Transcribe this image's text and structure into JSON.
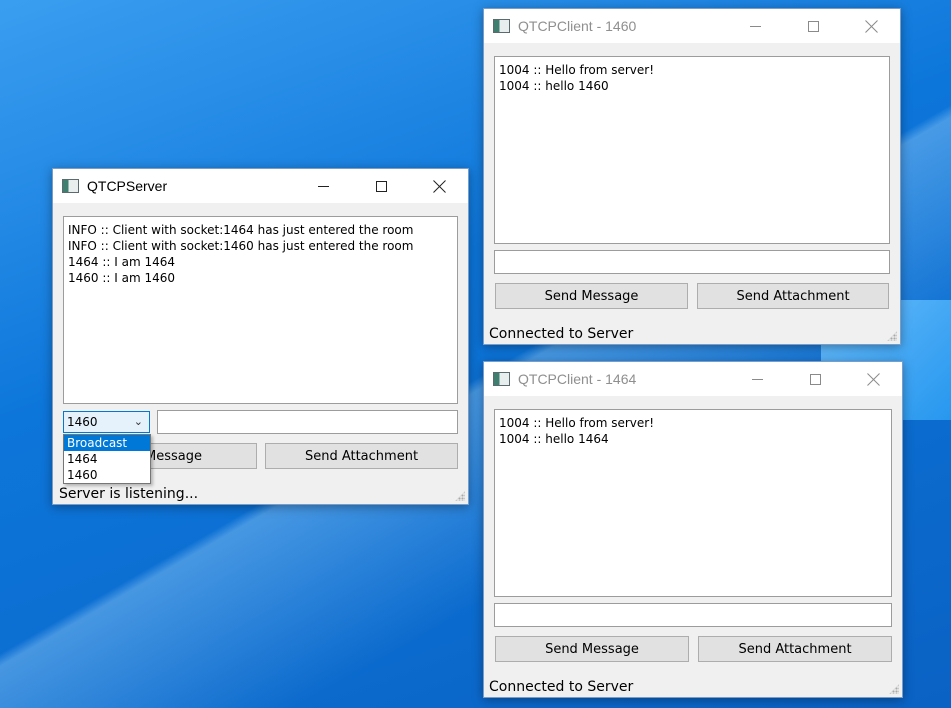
{
  "server": {
    "title": "QTCPServer",
    "log": [
      "INFO :: Client with socket:1464 has just entered the room",
      "INFO :: Client with socket:1460 has just entered the room",
      "1464 :: I am 1464",
      "1460 :: I am 1460"
    ],
    "combo_value": "1460",
    "combo_options": [
      "Broadcast",
      "1464",
      "1460"
    ],
    "send_message_label": "Send Message",
    "send_message_visible": "Message",
    "send_attachment_label": "Send Attachment",
    "status": "Server is listening..."
  },
  "client1460": {
    "title": "QTCPClient - 1460",
    "log": [
      "1004 :: Hello from server!",
      "1004 :: hello 1460"
    ],
    "send_message_label": "Send Message",
    "send_attachment_label": "Send Attachment",
    "status": "Connected to Server"
  },
  "client1464": {
    "title": "QTCPClient - 1464",
    "log": [
      "1004 :: Hello from server!",
      "1004 :: hello 1464"
    ],
    "send_message_label": "Send Message",
    "send_attachment_label": "Send Attachment",
    "status": "Connected to Server"
  },
  "colors": {
    "accent": "#0078d7",
    "desktop": "#0d76da"
  },
  "icons": {
    "window_controls": [
      "minimize-icon",
      "maximize-icon",
      "close-icon"
    ],
    "combo_arrow": "chevron-down-icon"
  }
}
